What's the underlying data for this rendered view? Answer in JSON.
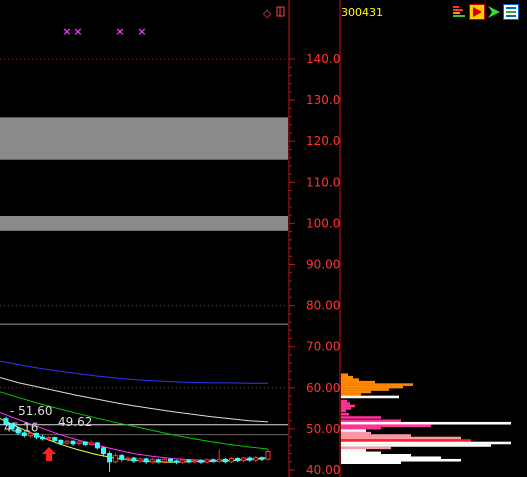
{
  "stock_code": "300431",
  "toolbar_icons": [
    "volume-bars-icon",
    "flag-icon",
    "arrow-right-icon",
    "chart-list-icon"
  ],
  "chart_data": {
    "type": "line",
    "price_axis": {
      "ylim": [
        40,
        150
      ],
      "tick_labels": [
        "140.0",
        "130.0",
        "120.0",
        "110.0",
        "100.0",
        "90.00",
        "80.00",
        "70.00",
        "60.00",
        "50.00",
        "40.00"
      ],
      "tick_values": [
        140,
        130,
        120,
        110,
        100,
        90,
        80,
        70,
        60,
        50,
        40
      ]
    },
    "gray_bands": [
      {
        "low": 115.5,
        "high": 125.8
      },
      {
        "low": 98.2,
        "high": 101.8
      }
    ],
    "reference_lines": [
      {
        "value": 75.5,
        "color": "#999999"
      },
      {
        "value": 51.0,
        "color": "#dddddd"
      }
    ],
    "dotted_levels": [
      140.0,
      80.0,
      60.0
    ],
    "price_labels": [
      {
        "text": "51.60",
        "value": 54.3
      },
      {
        "text": "49.62",
        "value": 51.7
      },
      {
        "text": "45.16",
        "value": 50.3
      }
    ],
    "markers": {
      "symbol": "×",
      "color": "#ff33ff",
      "count": 4
    },
    "red_arrow": true,
    "ma_lines": [
      {
        "color": "#3333ff",
        "values": [
          66.5,
          65.6,
          64.8,
          64.1,
          63.5,
          62.9,
          62.4,
          62.0,
          61.7,
          61.5,
          61.3,
          61.2,
          61.2,
          61.1,
          61.1
        ]
      },
      {
        "color": "#dddddd",
        "values": [
          62.5,
          61.2,
          60.2,
          59.2,
          58.2,
          57.3,
          56.4,
          55.6,
          54.9,
          54.2,
          53.6,
          53.0,
          52.5,
          52.0,
          51.7
        ]
      },
      {
        "color": "#00cc00",
        "values": [
          59.0,
          57.6,
          56.2,
          55.0,
          53.8,
          52.7,
          51.6,
          50.6,
          49.6,
          48.6,
          47.7,
          46.9,
          46.2,
          45.6,
          45.1
        ]
      },
      {
        "color": "#ff33ff",
        "values": [
          54.0,
          52.2,
          50.5,
          48.8,
          47.4,
          46.1,
          45.0,
          44.0,
          43.3,
          42.8,
          42.5,
          42.3,
          42.3,
          42.5,
          42.9
        ]
      },
      {
        "color": "#ffff33",
        "values": [
          52.5,
          50.3,
          48.3,
          46.5,
          45.0,
          43.8,
          42.9,
          42.3,
          42.0,
          41.9,
          42.0,
          42.1,
          42.3,
          42.6,
          43.0
        ]
      }
    ],
    "candles": [
      {
        "o": 52.5,
        "c": 51.2,
        "h": 53.0,
        "l": 50.8
      },
      {
        "o": 51.2,
        "c": 50.0,
        "h": 51.6,
        "l": 49.6
      },
      {
        "o": 50.0,
        "c": 49.0,
        "h": 50.5,
        "l": 48.5
      },
      {
        "o": 49.0,
        "c": 48.4,
        "h": 49.4,
        "l": 47.9
      },
      {
        "o": 48.4,
        "c": 48.9,
        "h": 49.3,
        "l": 47.8
      },
      {
        "o": 48.9,
        "c": 48.0,
        "h": 49.1,
        "l": 47.5
      },
      {
        "o": 48.0,
        "c": 47.6,
        "h": 48.5,
        "l": 47.2
      },
      {
        "o": 47.6,
        "c": 47.9,
        "h": 48.2,
        "l": 47.1
      },
      {
        "o": 47.9,
        "c": 47.2,
        "h": 48.1,
        "l": 46.8
      },
      {
        "o": 47.2,
        "c": 46.5,
        "h": 47.5,
        "l": 46.0
      },
      {
        "o": 46.5,
        "c": 47.0,
        "h": 47.4,
        "l": 46.1
      },
      {
        "o": 47.0,
        "c": 46.4,
        "h": 47.2,
        "l": 45.9
      },
      {
        "o": 46.4,
        "c": 46.8,
        "h": 47.1,
        "l": 46.0
      },
      {
        "o": 46.8,
        "c": 46.2,
        "h": 47.0,
        "l": 45.8
      },
      {
        "o": 46.2,
        "c": 46.6,
        "h": 47.1,
        "l": 45.9
      },
      {
        "o": 46.6,
        "c": 45.4,
        "h": 46.8,
        "l": 45.0
      },
      {
        "o": 45.4,
        "c": 44.0,
        "h": 45.7,
        "l": 43.2
      },
      {
        "o": 44.0,
        "c": 42.0,
        "h": 44.5,
        "l": 39.5
      },
      {
        "o": 42.0,
        "c": 43.5,
        "h": 44.2,
        "l": 41.6
      },
      {
        "o": 43.5,
        "c": 42.6,
        "h": 43.9,
        "l": 42.0
      },
      {
        "o": 42.6,
        "c": 42.9,
        "h": 43.3,
        "l": 42.1
      },
      {
        "o": 42.9,
        "c": 42.2,
        "h": 43.2,
        "l": 41.7
      },
      {
        "o": 42.2,
        "c": 42.7,
        "h": 43.0,
        "l": 41.8
      },
      {
        "o": 42.7,
        "c": 42.0,
        "h": 43.0,
        "l": 41.5
      },
      {
        "o": 42.0,
        "c": 42.5,
        "h": 42.9,
        "l": 41.6
      },
      {
        "o": 42.5,
        "c": 42.1,
        "h": 42.8,
        "l": 41.6
      },
      {
        "o": 42.1,
        "c": 42.6,
        "h": 43.0,
        "l": 41.7
      },
      {
        "o": 42.6,
        "c": 42.2,
        "h": 42.9,
        "l": 41.8
      },
      {
        "o": 42.2,
        "c": 41.9,
        "h": 42.5,
        "l": 41.4
      },
      {
        "o": 41.9,
        "c": 42.4,
        "h": 42.8,
        "l": 41.5
      },
      {
        "o": 42.4,
        "c": 42.0,
        "h": 42.7,
        "l": 41.6
      },
      {
        "o": 42.0,
        "c": 42.3,
        "h": 42.6,
        "l": 41.6
      },
      {
        "o": 42.3,
        "c": 41.9,
        "h": 42.6,
        "l": 41.5
      },
      {
        "o": 41.9,
        "c": 42.5,
        "h": 42.8,
        "l": 41.6
      },
      {
        "o": 42.5,
        "c": 42.1,
        "h": 42.8,
        "l": 41.7
      },
      {
        "o": 42.1,
        "c": 42.6,
        "h": 45.0,
        "l": 41.8
      },
      {
        "o": 42.6,
        "c": 42.0,
        "h": 42.9,
        "l": 41.6
      },
      {
        "o": 42.0,
        "c": 42.8,
        "h": 43.1,
        "l": 41.7
      },
      {
        "o": 42.8,
        "c": 42.3,
        "h": 43.1,
        "l": 41.9
      },
      {
        "o": 42.3,
        "c": 42.9,
        "h": 43.2,
        "l": 41.9
      },
      {
        "o": 42.9,
        "c": 42.4,
        "h": 43.3,
        "l": 42.0
      },
      {
        "o": 42.4,
        "c": 43.0,
        "h": 43.4,
        "l": 42.0
      },
      {
        "o": 43.0,
        "c": 42.6,
        "h": 43.3,
        "l": 42.2
      },
      {
        "o": 42.6,
        "c": 44.5,
        "h": 45.2,
        "l": 42.3
      }
    ],
    "volume_profile": [
      {
        "price": 63.2,
        "len": 7,
        "color": "#ff8800"
      },
      {
        "price": 62.6,
        "len": 12,
        "color": "#ff8800"
      },
      {
        "price": 62.0,
        "len": 18,
        "color": "#ff8800"
      },
      {
        "price": 61.4,
        "len": 34,
        "color": "#ff8800"
      },
      {
        "price": 60.8,
        "len": 72,
        "color": "#ff8800"
      },
      {
        "price": 60.2,
        "len": 62,
        "color": "#ff8800"
      },
      {
        "price": 59.6,
        "len": 48,
        "color": "#ff8800"
      },
      {
        "price": 59.0,
        "len": 30,
        "color": "#ff8800"
      },
      {
        "price": 58.4,
        "len": 20,
        "color": "#ff8800"
      },
      {
        "price": 57.8,
        "len": 58,
        "color": "#ffffff"
      },
      {
        "price": 56.8,
        "len": 6,
        "color": "#ff3399"
      },
      {
        "price": 56.2,
        "len": 9,
        "color": "#ff3399"
      },
      {
        "price": 55.6,
        "len": 14,
        "color": "#ff3399"
      },
      {
        "price": 55.0,
        "len": 10,
        "color": "#ff3399"
      },
      {
        "price": 54.4,
        "len": 5,
        "color": "#ff3399"
      },
      {
        "price": 53.6,
        "len": 8,
        "color": "#ff3399"
      },
      {
        "price": 52.8,
        "len": 40,
        "color": "#ff3399"
      },
      {
        "price": 52.0,
        "len": 60,
        "color": "#ff3399"
      },
      {
        "price": 51.4,
        "len": 170,
        "color": "#ffffff"
      },
      {
        "price": 50.8,
        "len": 90,
        "color": "#ff3399"
      },
      {
        "price": 50.2,
        "len": 40,
        "color": "#ff3399"
      },
      {
        "price": 49.6,
        "len": 25,
        "color": "#ffffff"
      },
      {
        "price": 49.0,
        "len": 30,
        "color": "#ff99aa"
      },
      {
        "price": 48.4,
        "len": 70,
        "color": "#ff99aa"
      },
      {
        "price": 47.8,
        "len": 120,
        "color": "#ff99aa"
      },
      {
        "price": 47.2,
        "len": 130,
        "color": "#ff2222"
      },
      {
        "price": 46.6,
        "len": 170,
        "color": "#ffffff"
      },
      {
        "price": 46.0,
        "len": 150,
        "color": "#ffffff"
      },
      {
        "price": 45.4,
        "len": 50,
        "color": "#ff99aa"
      },
      {
        "price": 44.8,
        "len": 25,
        "color": "#ffffff"
      },
      {
        "price": 44.2,
        "len": 40,
        "color": "#ffffff"
      },
      {
        "price": 43.6,
        "len": 70,
        "color": "#ffffff"
      },
      {
        "price": 43.0,
        "len": 100,
        "color": "#ffffff"
      },
      {
        "price": 42.4,
        "len": 120,
        "color": "#ffffff"
      },
      {
        "price": 41.8,
        "len": 60,
        "color": "#ffffff"
      }
    ]
  }
}
